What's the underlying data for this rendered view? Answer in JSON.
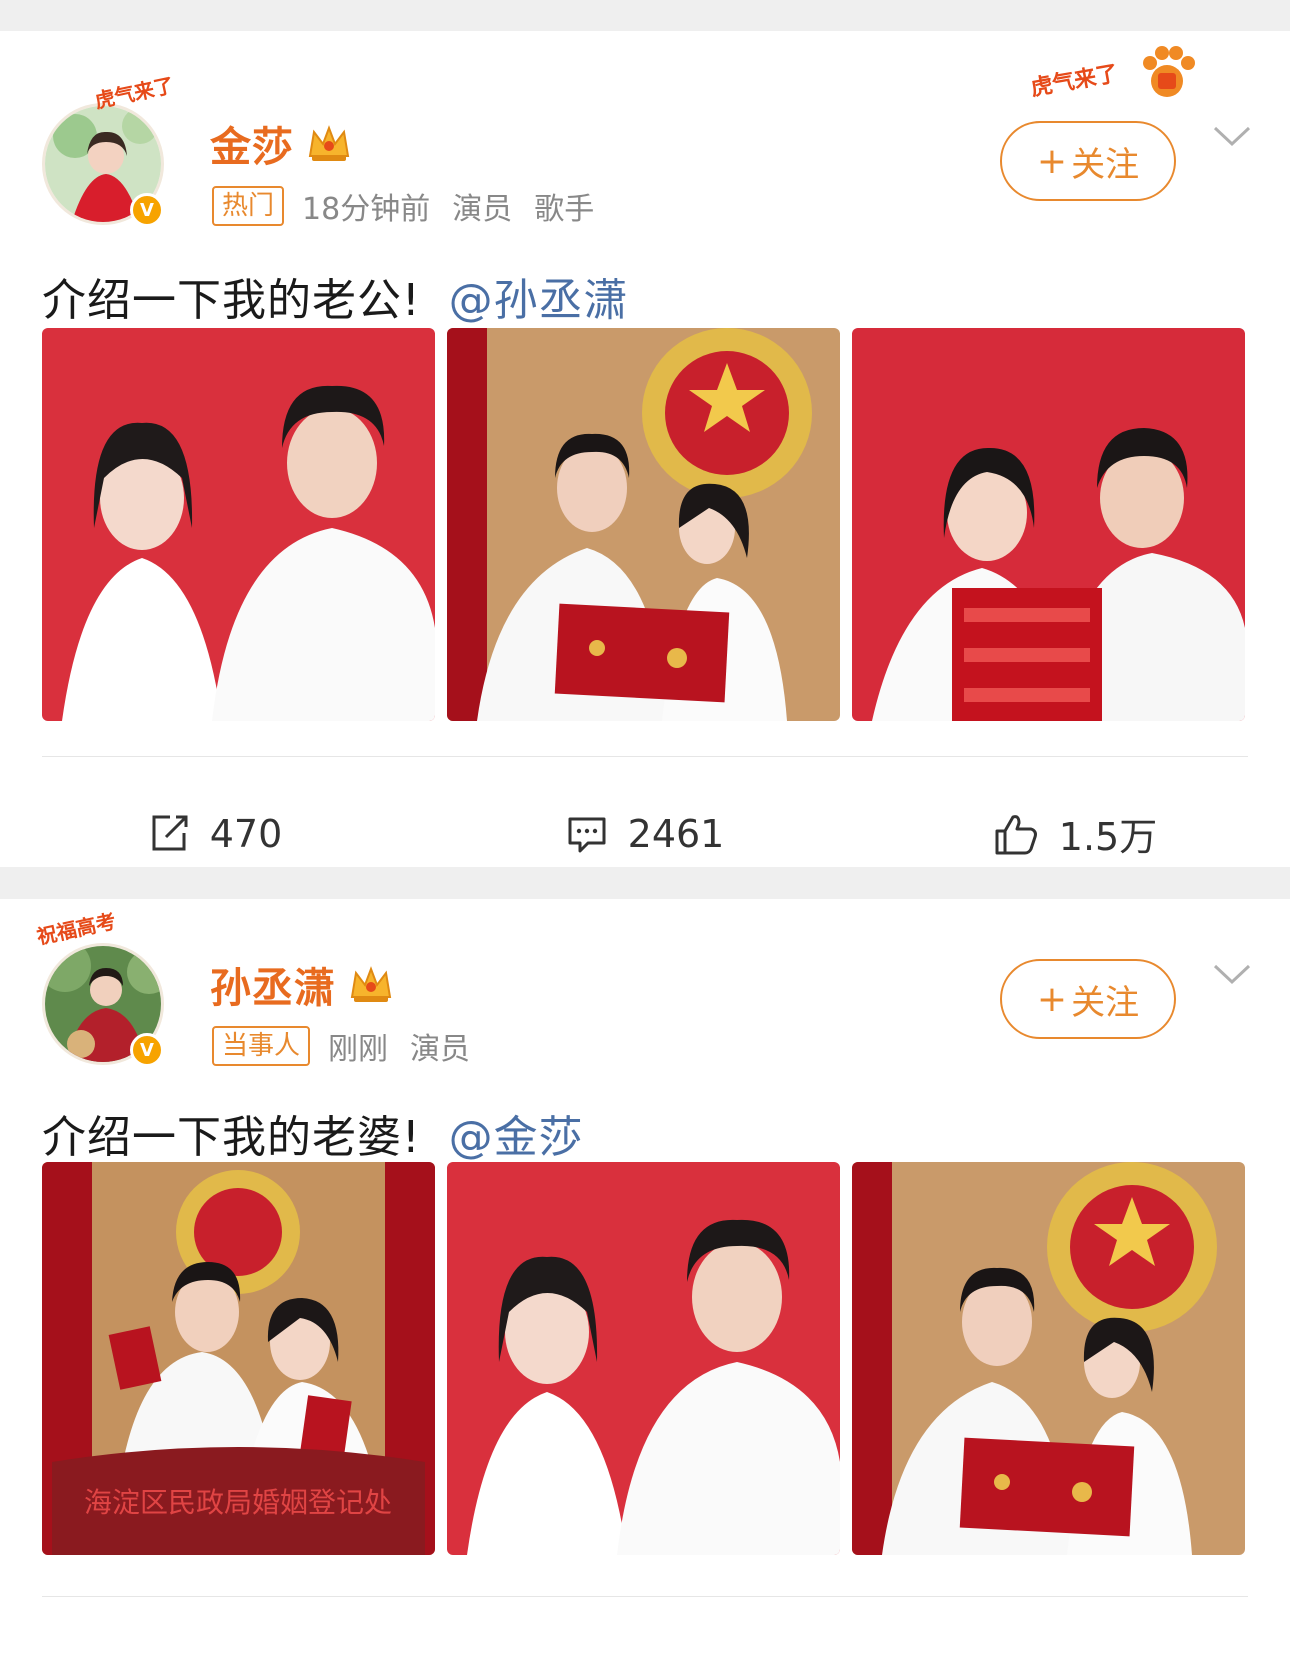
{
  "posts": [
    {
      "avatar_badge": "虎气来了",
      "verified_mark": "V",
      "username": "金莎",
      "tag": "热门",
      "time": "18分钟前",
      "roles": [
        "演员",
        "歌手"
      ],
      "follow_label": "关注",
      "sticker_text": "虎气来了",
      "text": "介绍一下我的老公!",
      "mention": "@孙丞潇",
      "photos": [
        "red-background-couple-portrait",
        "couple-holding-marriage-certificate",
        "couple-holding-xi-character"
      ],
      "actions": {
        "share": "470",
        "comment": "2461",
        "like": "1.5万"
      }
    },
    {
      "avatar_badge": "祝福高考",
      "verified_mark": "V",
      "username": "孙丞潇",
      "tag": "当事人",
      "time": "刚刚",
      "roles": [
        "演员"
      ],
      "follow_label": "关注",
      "text": "介绍一下我的老婆!",
      "mention": "@金莎",
      "photos": [
        "couple-at-registry-desk",
        "red-background-couple-portrait",
        "couple-holding-marriage-certificate"
      ],
      "desk_sign": "海淀区民政局婚姻登记处"
    }
  ],
  "colors": {
    "accent": "#e8892e",
    "username": "#e86b1f",
    "mention": "#4a6fa5",
    "photo_red": "#d9303d"
  },
  "icons": [
    "share-icon",
    "comment-icon",
    "like-icon",
    "crown-icon",
    "chevron-down-icon"
  ]
}
